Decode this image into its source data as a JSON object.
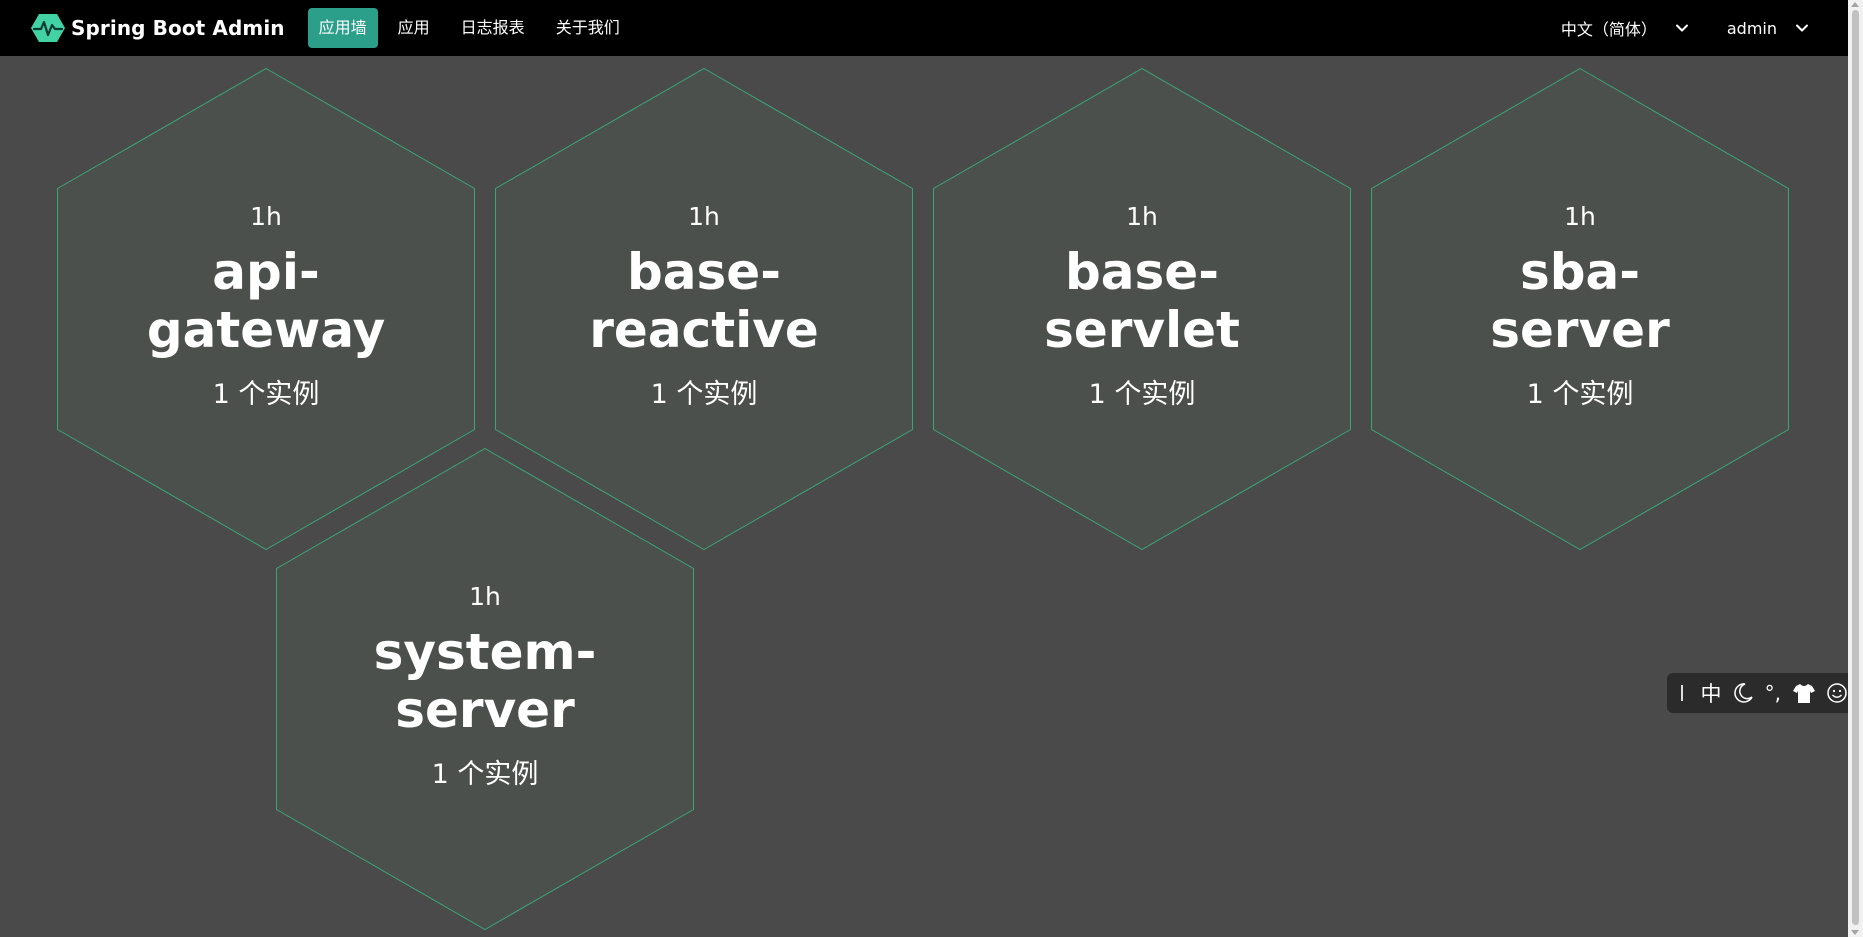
{
  "navbar": {
    "brand": "Spring Boot Admin",
    "brand_icon": "heartbeat-hexagon-icon",
    "brand_color": "#42d3a5",
    "items": [
      {
        "label": "应用墙",
        "active": true
      },
      {
        "label": "应用",
        "active": false
      },
      {
        "label": "日志报表",
        "active": false
      },
      {
        "label": "关于我们",
        "active": false
      }
    ],
    "active_color": "#2c9f8a",
    "language": "中文（简体）",
    "user": "admin"
  },
  "wall": {
    "applications": [
      {
        "uptime": "1h",
        "name": "api-gateway",
        "name_lines": [
          "api-",
          "gateway"
        ],
        "instances": "1 个实例"
      },
      {
        "uptime": "1h",
        "name": "base-reactive",
        "name_lines": [
          "base-",
          "reactive"
        ],
        "instances": "1 个实例"
      },
      {
        "uptime": "1h",
        "name": "base-servlet",
        "name_lines": [
          "base-",
          "servlet"
        ],
        "instances": "1 个实例"
      },
      {
        "uptime": "1h",
        "name": "sba-server",
        "name_lines": [
          "sba-",
          "server"
        ],
        "instances": "1 个实例"
      },
      {
        "uptime": "1h",
        "name": "system-server",
        "name_lines": [
          "system-",
          "server"
        ],
        "instances": "1 个实例"
      }
    ],
    "hex_fill": "#4b504d",
    "hex_stroke": "#3aa676",
    "background": "#4a4a4a"
  },
  "ime_toolbar": {
    "mode_label": "中",
    "punct_label": "°,",
    "icons": [
      "cursor-divider-icon",
      "moon-icon",
      "tshirt-icon",
      "smiley-icon"
    ]
  }
}
